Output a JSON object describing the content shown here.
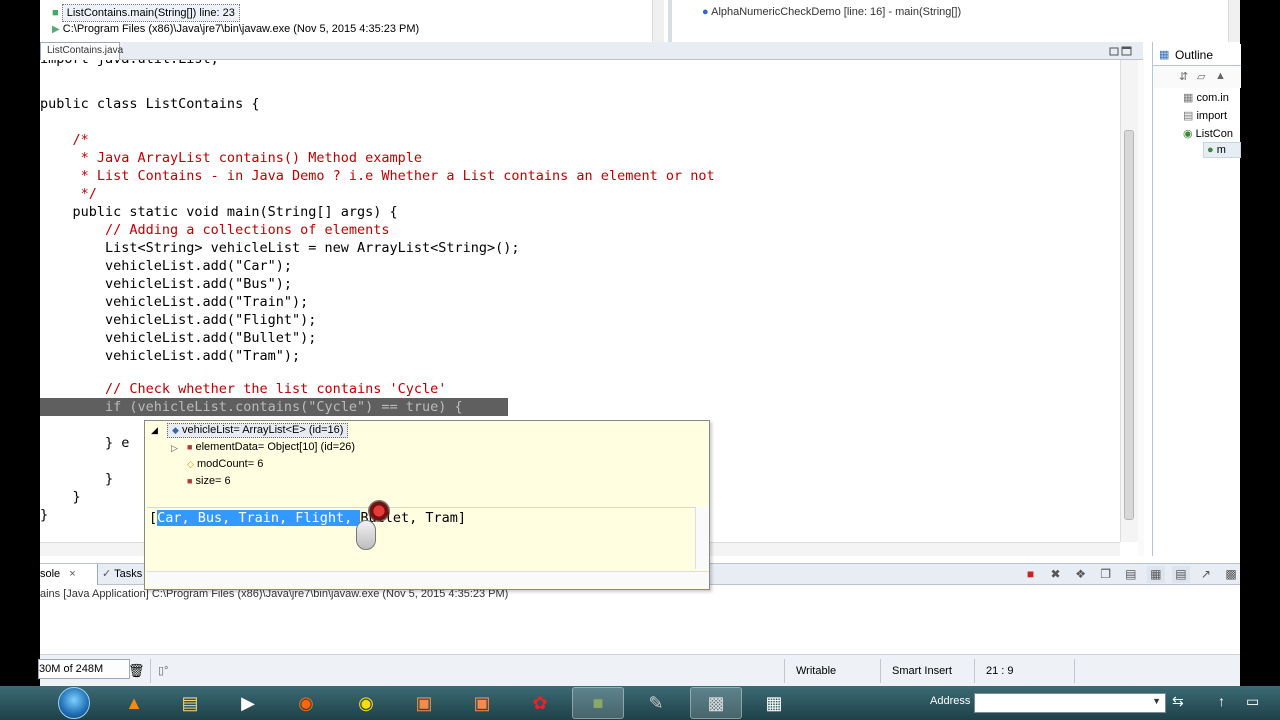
{
  "debug": {
    "stack_frame": "ListContains.main(String[]) line: 23",
    "process": "C:\\Program Files (x86)\\Java\\jre7\\bin\\javaw.exe (Nov 5, 2015 4:35:23 PM)",
    "right_frame": "AlphaNumericCheckDemo [line: 16] - main(String[])"
  },
  "editor": {
    "tab": "ListContains.java",
    "lines": [
      "import java.util.List;",
      "",
      "public class ListContains {",
      "",
      "    /*",
      "     * Java ArrayList contains() Method example",
      "     * List Contains - in Java Demo ? i.e Whether a List contains an element or not",
      "     */",
      "    public static void main(String[] args) {",
      "        // Adding a collections of elements",
      "        List<String> vehicleList = new ArrayList<String>();",
      "        vehicleList.add(\"Car\");",
      "        vehicleList.add(\"Bus\");",
      "        vehicleList.add(\"Train\");",
      "        vehicleList.add(\"Flight\");",
      "        vehicleList.add(\"Bullet\");",
      "        vehicleList.add(\"Tram\");",
      "",
      "        // Check whether the list contains 'Cycle'",
      "        if (vehicleList.contains(\"Cycle\") == true) {",
      "",
      "        } else {",
      "",
      "        }",
      "    }",
      "}"
    ],
    "line_visible_part": "        } e"
  },
  "outline": {
    "tab": "Outline",
    "items": [
      "com.in",
      "import",
      "ListCon",
      "m"
    ]
  },
  "popup": {
    "root": "vehicleList= ArrayList<E>  (id=16)",
    "children": [
      "elementData= Object[10]  (id=26)",
      "modCount= 6",
      "size= 6"
    ],
    "detail_pre": "[",
    "detail_sel": "Car, Bus, Train, Flight, ",
    "detail_post": "Bullet, Tram]"
  },
  "console": {
    "tab": "Console",
    "tab_visible": "sole",
    "tasks_tab": "Tasks",
    "status": "ains [Java Application] C:\\Program Files (x86)\\Java\\jre7\\bin\\javaw.exe (Nov 5, 2015 4:35:23 PM)"
  },
  "statusbar": {
    "heap": "30M of 248M",
    "writable": "Writable",
    "insert_mode": "Smart Insert",
    "position": "21 : 9"
  },
  "taskbar": {
    "address_label": "Address"
  }
}
